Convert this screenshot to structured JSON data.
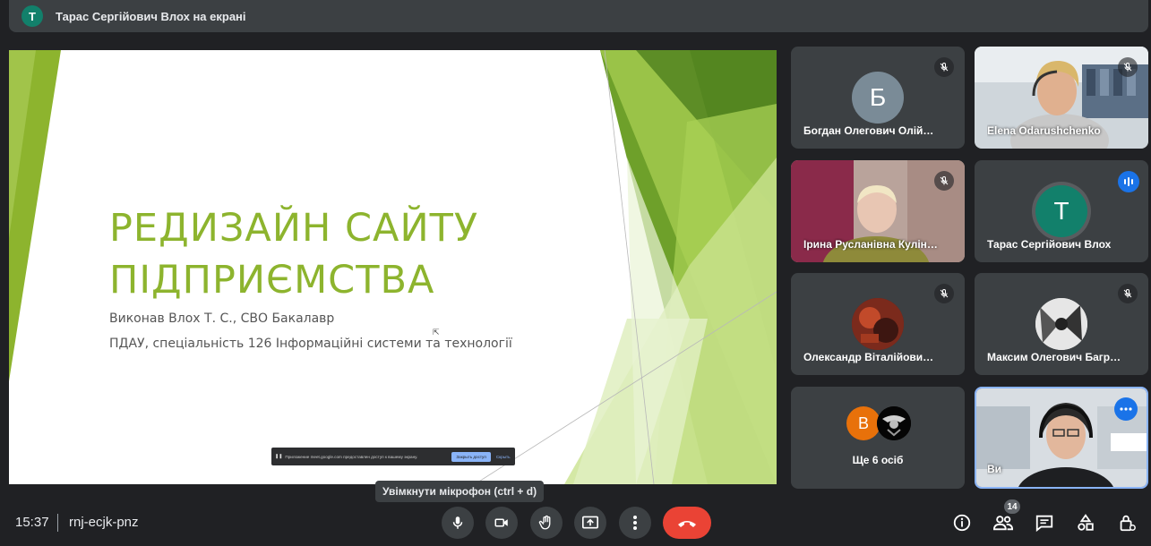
{
  "top": {
    "presenter_initial": "Т",
    "presenter_label": "Тарас Сергійович Влох на екрані"
  },
  "slide": {
    "title_line1": "РЕДИЗАЙН САЙТУ",
    "title_line2": "ПІДПРИЄМСТВА",
    "subtitle1": "Виконав Влох Т. С., СВО Бакалавр",
    "subtitle2": "ПДАУ, спеціальність 126 Інформаційні системи та технології",
    "share_notice": "Приложение meet.google.com предоставлен доступ к вашему экрану.",
    "share_stop": "Закрыть доступ",
    "share_hide": "Скрыть"
  },
  "participants": [
    {
      "name": "Богдан Олегович Олій…",
      "initial": "Б",
      "color": "#7a8b97",
      "muted": true
    },
    {
      "name": "Elena Odarushchenko",
      "muted": true,
      "video": true
    },
    {
      "name": "Ірина Русланівна Кулін…",
      "muted": true,
      "video": true
    },
    {
      "name": "Тарас Сергійович Влох",
      "initial": "Т",
      "color": "#12806b",
      "speaking": true
    },
    {
      "name": "Олександр Віталійови…",
      "muted": true
    },
    {
      "name": "Максим Олегович Багр…",
      "muted": true
    },
    {
      "name": "Ще 6 осіб",
      "initial": "В",
      "color": "#e8710a"
    },
    {
      "name": "Ви",
      "video": true,
      "self": true
    }
  ],
  "tooltip": "Увімкнути мікрофон (ctrl + d)",
  "bottom": {
    "time": "15:37",
    "meeting_code": "rnj-ecjk-pnz",
    "people_count": "14"
  },
  "icons": {
    "mic": "mic-icon",
    "camera": "camera-icon",
    "hand": "raise-hand-icon",
    "present": "present-icon",
    "more": "more-vert-icon",
    "end": "end-call-icon",
    "info": "info-icon",
    "people": "people-icon",
    "chat": "chat-icon",
    "activities": "activities-icon",
    "lock": "host-controls-icon"
  },
  "colors": {
    "end_call": "#ea4335",
    "accent": "#1a73e8",
    "slide_title": "#8db42e"
  }
}
